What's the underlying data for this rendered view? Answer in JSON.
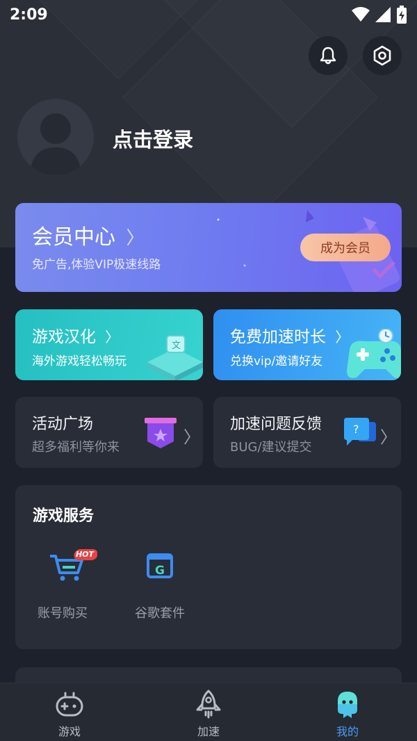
{
  "status_bar": {
    "time": "2:09"
  },
  "header": {
    "login_text": "点击登录"
  },
  "vip": {
    "title": "会员中心",
    "subtitle": "免广告,体验VIP极速线路",
    "button": "成为会员"
  },
  "promo_cards": [
    {
      "title": "游戏汉化",
      "subtitle": "海外游戏轻松畅玩"
    },
    {
      "title": "免费加速时长",
      "subtitle": "兑换vip/邀请好友"
    }
  ],
  "link_cards": [
    {
      "title": "活动广场",
      "subtitle": "超多福利等你来"
    },
    {
      "title": "加速问题反馈",
      "subtitle": "BUG/建议提交"
    }
  ],
  "game_services": {
    "title": "游戏服务",
    "items": [
      {
        "label": "账号购买",
        "badge": "HOT",
        "icon": "cart-icon"
      },
      {
        "label": "谷歌套件",
        "badge": "",
        "icon": "google-suite-icon"
      }
    ]
  },
  "tabbar": {
    "tabs": [
      {
        "label": "游戏",
        "icon": "gamepad-icon",
        "active": false
      },
      {
        "label": "加速",
        "icon": "rocket-icon",
        "active": false
      },
      {
        "label": "我的",
        "icon": "mascot-icon",
        "active": true
      }
    ]
  },
  "colors": {
    "background": "#1c212b",
    "card": "#282d37",
    "accent": "#4a9cf6",
    "vip_gradient_start": "#7a8bee",
    "vip_gradient_end": "#6c63f1",
    "vip_button": "#f3b496",
    "teal_card": "#2fc4c7",
    "blue_card": "#3a9df2"
  }
}
